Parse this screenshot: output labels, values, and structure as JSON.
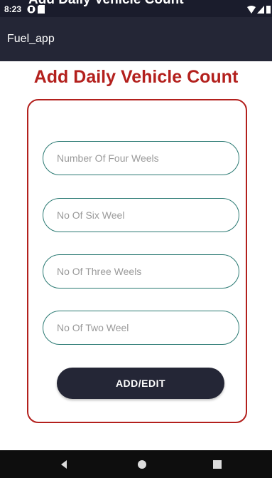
{
  "status_bar": {
    "time": "8:23",
    "overlay_text": "Add Daily Vehicle Count"
  },
  "app_bar": {
    "title": "Fuel_app"
  },
  "page": {
    "heading": "Add Daily Vehicle Count"
  },
  "form": {
    "fields": [
      {
        "placeholder": "Number Of Four Weels",
        "value": ""
      },
      {
        "placeholder": "No Of Six Weel",
        "value": ""
      },
      {
        "placeholder": "No Of Three Weels",
        "value": ""
      },
      {
        "placeholder": "No Of Two Weel",
        "value": ""
      }
    ],
    "submit_label": "ADD/EDIT"
  },
  "nav_bar": {
    "icons": [
      "back-icon",
      "home-icon",
      "recents-icon"
    ]
  },
  "colors": {
    "accent": "#b3201d",
    "app_bar": "#242636",
    "field_border": "#2b7a73"
  }
}
